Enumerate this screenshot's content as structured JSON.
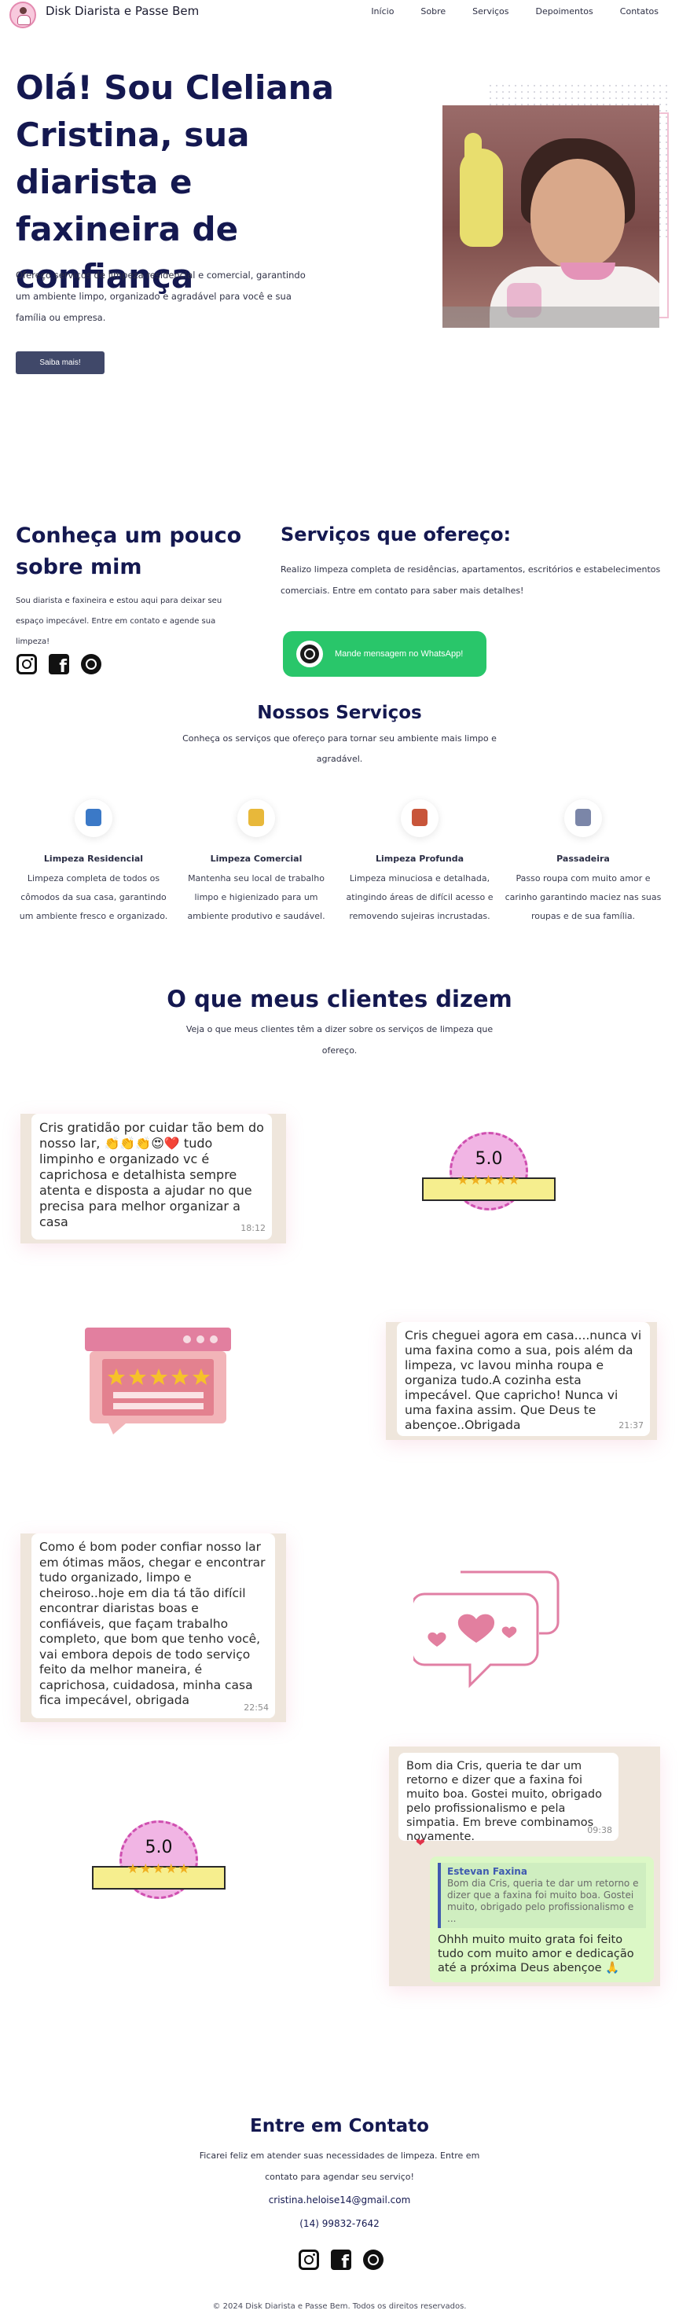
{
  "brand": "Disk Diarista e Passe Bem",
  "nav": [
    "Início",
    "Sobre",
    "Serviços",
    "Depoimentos",
    "Contatos"
  ],
  "hero": {
    "title": "Olá! Sou Cleliana Cristina, sua diarista e faxineira de confiança",
    "text": "Ofereço serviços de limpeza residencial e comercial, garantindo um ambiente limpo, organizado e agradável para você e sua família ou empresa.",
    "button": "Saiba mais!"
  },
  "about": {
    "title": "Conheça um pouco sobre mim",
    "text": "Sou diarista e faxineira e estou aqui para deixar seu espaço impecável. Entre em contato e agende sua limpeza!"
  },
  "services_intro": {
    "title": "Serviços que ofereço:",
    "text": "Realizo limpeza completa de residências, apartamentos, escritórios e estabelecimentos comerciais. Entre em contato para saber mais detalhes!",
    "whatsapp_button": "Mande mensagem no WhatsApp!"
  },
  "services": {
    "title": "Nossos Serviços",
    "subtitle": "Conheça os serviços que ofereço para tornar seu ambiente mais limpo e agradável.",
    "items": [
      {
        "name": "Limpeza Residencial",
        "desc": "Limpeza completa de todos os cômodos da sua casa, garantindo um ambiente fresco e organizado.",
        "icon": "house-cleaning-icon"
      },
      {
        "name": "Limpeza Comercial",
        "desc": "Mantenha seu local de trabalho limpo e higienizado para um ambiente produtivo e saudável.",
        "icon": "spray-bottle-icon"
      },
      {
        "name": "Limpeza Profunda",
        "desc": "Limpeza minuciosa e detalhada, atingindo áreas de difícil acesso e removendo sujeiras incrustadas.",
        "icon": "cleaning-supplies-icon"
      },
      {
        "name": "Passadeira",
        "desc": "Passo roupa com muito amor e carinho garantindo maciez nas suas roupas e de sua família.",
        "icon": "iron-icon"
      }
    ]
  },
  "testimonials": {
    "title": "O que meus clientes dizem",
    "subtitle": "Veja o que meus clientes têm a dizer sobre os serviços de limpeza que ofereço.",
    "msg1": {
      "text": "Cris gratidão por cuidar tão bem do nosso lar, 👏👏👏😍❤️ tudo limpinho e organizado vc é caprichosa e detalhista sempre atenta e disposta a ajudar no que precisa para melhor organizar a casa",
      "time": "18:12"
    },
    "msg2": {
      "text": "Cris cheguei agora em casa....nunca vi uma faxina como a sua, pois além da limpeza, vc lavou minha  roupa e organiza tudo.A cozinha esta impecável. Que capricho! Nunca vi uma faxina assim. Que Deus te abençoe..Obrigada",
      "time": "21:37"
    },
    "msg3": {
      "text": "Como é bom poder confiar nosso lar em ótimas mãos, chegar e encontrar tudo organizado, limpo e cheiroso..hoje em dia tá tão difícil encontrar diaristas boas e confiáveis, que façam trabalho completo, que bom que tenho você, vai embora depois de todo serviço feito da melhor maneira, é caprichosa, cuidadosa, minha casa fica impecável, obrigada",
      "time": "22:54"
    },
    "msg4": {
      "text": "Bom dia Cris, queria te dar um retorno e dizer que a faxina foi muito boa. Gostei muito, obrigado pelo profissionalismo e pela simpatia. Em breve combinamos novamente.",
      "time": "09:38"
    },
    "msg4_reply": {
      "author": "Estevan Faxina",
      "quote": "Bom dia Cris, queria te dar um retorno e dizer que a faxina foi muito boa. Gostei muito, obrigado pelo profissionalismo e ...",
      "text": "Ohhh muito muito grata  foi feito tudo com muito amor e dedicação até  a próxima Deus abençoe 🙏"
    },
    "rating": "5.0",
    "stars": "★★★★★"
  },
  "contact": {
    "title": "Entre em Contato",
    "text": "Ficarei feliz em atender suas necessidades de limpeza. Entre em contato para agendar seu serviço!",
    "email": "cristina.heloise14@gmail.com",
    "phone": "(14) 99832-7642"
  },
  "footer": "© 2024 Disk Diarista e Passe Bem. Todos os direitos reservados.",
  "colors": {
    "primary": "#141850",
    "button": "#404869",
    "whatsapp": "#29c66a",
    "accent_pink": "#e48ab0"
  }
}
